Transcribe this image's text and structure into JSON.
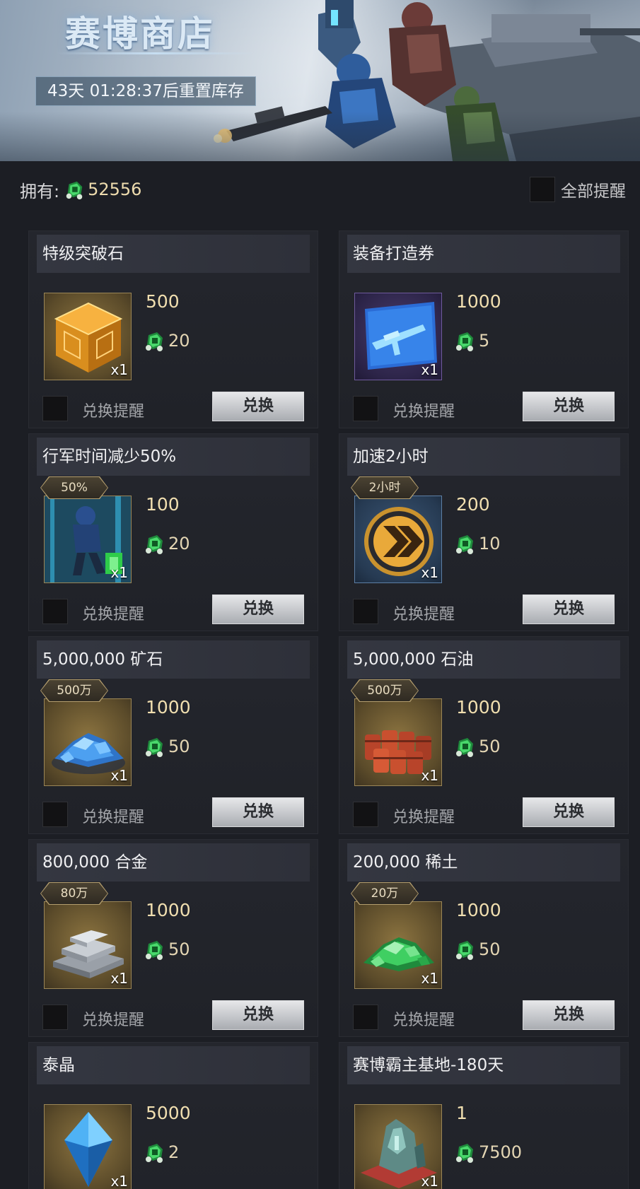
{
  "banner": {
    "title": "赛博商店",
    "reset_timer": "43天 01:28:37后重置库存"
  },
  "owned": {
    "label": "拥有:",
    "amount": "52556",
    "currency_icon": "green-cyber-token-icon"
  },
  "remind_all": {
    "label": "全部提醒",
    "checked": false
  },
  "items": [
    {
      "name": "特级突破石",
      "price": "500",
      "stock": "20",
      "qty": "x1",
      "tag": "",
      "icon": "orange-cube-icon",
      "frame": "gold"
    },
    {
      "name": "装备打造券",
      "price": "1000",
      "stock": "5",
      "qty": "x1",
      "tag": "",
      "icon": "rifle-blueprint-icon",
      "frame": "purple"
    },
    {
      "name": "行军时间减少50%",
      "price": "100",
      "stock": "20",
      "qty": "x1",
      "tag": "50%",
      "icon": "marching-soldier-icon",
      "frame": "gold"
    },
    {
      "name": "加速2小时",
      "price": "200",
      "stock": "10",
      "qty": "x1",
      "tag": "2小时",
      "icon": "speedup-chevron-icon",
      "frame": "blue"
    },
    {
      "name": "5,000,000  矿石",
      "price": "1000",
      "stock": "50",
      "qty": "x1",
      "tag": "500万",
      "icon": "ore-pile-icon",
      "frame": "gold"
    },
    {
      "name": "5,000,000  石油",
      "price": "1000",
      "stock": "50",
      "qty": "x1",
      "tag": "500万",
      "icon": "oil-barrels-icon",
      "frame": "gold"
    },
    {
      "name": "800,000  合金",
      "price": "1000",
      "stock": "50",
      "qty": "x1",
      "tag": "80万",
      "icon": "alloy-ingots-icon",
      "frame": "gold"
    },
    {
      "name": "200,000  稀土",
      "price": "1000",
      "stock": "50",
      "qty": "x1",
      "tag": "20万",
      "icon": "rare-earth-pile-icon",
      "frame": "gold"
    },
    {
      "name": "泰晶",
      "price": "5000",
      "stock": "2",
      "qty": "x1",
      "tag": "",
      "icon": "blue-crystal-icon",
      "frame": "gold"
    },
    {
      "name": "赛博霸主基地-180天",
      "price": "1",
      "stock": "7500",
      "qty": "x1",
      "tag": "",
      "icon": "cyber-base-icon",
      "frame": "gold"
    }
  ],
  "labels": {
    "remind": "兑换提醒",
    "exchange": "兑换"
  },
  "colors": {
    "price": "#f1dfb0",
    "page_bg": "#1c1e24",
    "card_bg": "#24262d",
    "token_green": "#37c45a"
  }
}
